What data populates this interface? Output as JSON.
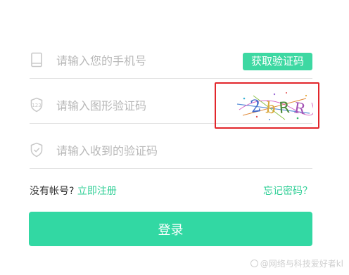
{
  "form": {
    "phone": {
      "placeholder": "请输入您的手机号",
      "value": "",
      "icon": "phone-icon"
    },
    "captcha": {
      "placeholder": "请输入图形验证码",
      "value": "",
      "icon": "captcha-shield-icon"
    },
    "sms_code": {
      "placeholder": "请输入收到的验证码",
      "value": "",
      "icon": "shield-check-icon"
    },
    "get_code_label": "获取验证码",
    "captcha_image": {
      "characters": "2bRR",
      "highlight_border_color": "#e2262b"
    }
  },
  "register": {
    "prompt": "没有帐号?",
    "link_label": "立即注册"
  },
  "forgot_label": "忘记密码？",
  "login_label": "登录",
  "watermark": "@网络与科技爱好者kl",
  "colors": {
    "accent": "#32d8a3",
    "link": "#2fcf96",
    "placeholder": "#b8b8b8"
  }
}
